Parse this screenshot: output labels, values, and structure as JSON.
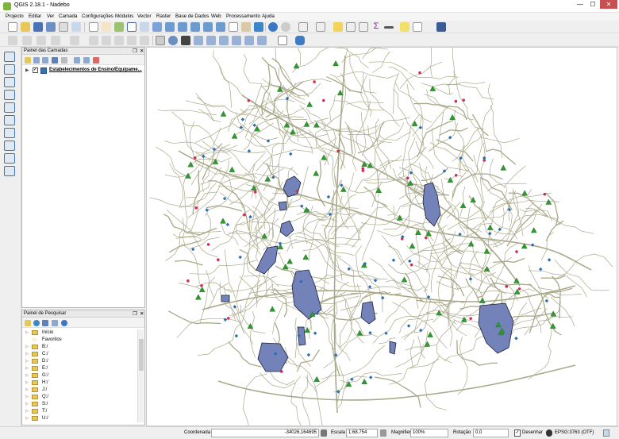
{
  "window": {
    "title": "QGIS 2.18.1 - Nadebo",
    "minimize": "—",
    "maximize": "☐",
    "close": "✕"
  },
  "menu": [
    "Projecto",
    "Editar",
    "Ver",
    "Camada",
    "Configurações",
    "Módulos",
    "Vector",
    "Raster",
    "Base de Dados",
    "Web",
    "Processamento",
    "Ajuda"
  ],
  "layers_panel": {
    "title": "Painel das Camadas",
    "layer_name": "Estabelecimentos de Ensino/Equipame...",
    "layer_checked": "✓"
  },
  "browser_panel": {
    "title": "Painel de Pesquisar",
    "items": [
      {
        "label": "Início",
        "kind": "folder"
      },
      {
        "label": "Favoritos",
        "kind": "star"
      },
      {
        "label": "B:/",
        "kind": "folder"
      },
      {
        "label": "C:/",
        "kind": "folder"
      },
      {
        "label": "D:/",
        "kind": "folder"
      },
      {
        "label": "E:/",
        "kind": "folder"
      },
      {
        "label": "G:/",
        "kind": "folder"
      },
      {
        "label": "H:/",
        "kind": "folder"
      },
      {
        "label": "J:/",
        "kind": "folder"
      },
      {
        "label": "Q:/",
        "kind": "folder"
      },
      {
        "label": "S:/",
        "kind": "folder"
      },
      {
        "label": "T:/",
        "kind": "folder"
      },
      {
        "label": "U:/",
        "kind": "folder"
      }
    ]
  },
  "statusbar": {
    "coordinate_label": "Coordenada",
    "coordinate_value": "-34026,164695",
    "scale_label": "Escala",
    "scale_value": "1:68.754",
    "magnifier_label": "Magnifier",
    "magnifier_value": "100%",
    "rotation_label": "Rotação",
    "rotation_value": "0,0",
    "render_label": "Desenhar",
    "crs_label": "EPSG:3763 (OTF)"
  },
  "colors": {
    "roads": "#a9a98a",
    "polygons_fill": "#7382b8",
    "polygons_stroke": "#1b1f3a",
    "points_green": "#2e9a2e",
    "points_blue": "#2a6db3",
    "points_red": "#d42a5b"
  }
}
